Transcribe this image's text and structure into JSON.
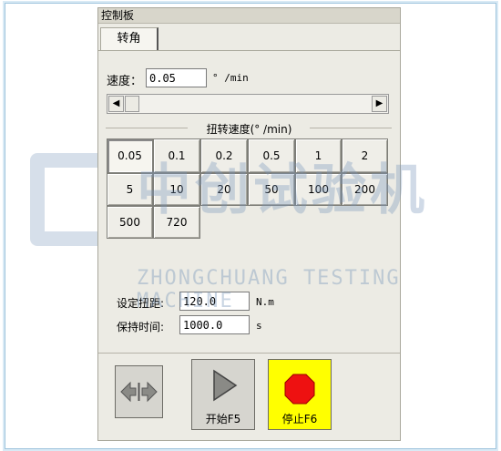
{
  "panel": {
    "title": "控制板"
  },
  "tabs": [
    {
      "label": "转角"
    }
  ],
  "speed": {
    "label": "速度：",
    "value": "0.05",
    "unit": "° /min"
  },
  "group": {
    "title": "扭转速度(° /min)",
    "buttons": [
      "0.05",
      "0.1",
      "0.2",
      "0.5",
      "1",
      "2",
      "5",
      "10",
      "20",
      "50",
      "100",
      "200",
      "500",
      "720"
    ],
    "selected": "0.05"
  },
  "torque": {
    "label": "设定扭距:",
    "value": "120.0",
    "unit": "N.m"
  },
  "hold": {
    "label": "保持时间:",
    "value": "1000.0",
    "unit": "s"
  },
  "controls": {
    "start_label": "开始F5",
    "stop_label": "停止F6",
    "stop_color": "#ffff00",
    "stop_icon_color": "#ee1111"
  },
  "watermark": {
    "main": "中创试验机",
    "sub": "ZHONGCHUANG TESTING MACHINE"
  }
}
